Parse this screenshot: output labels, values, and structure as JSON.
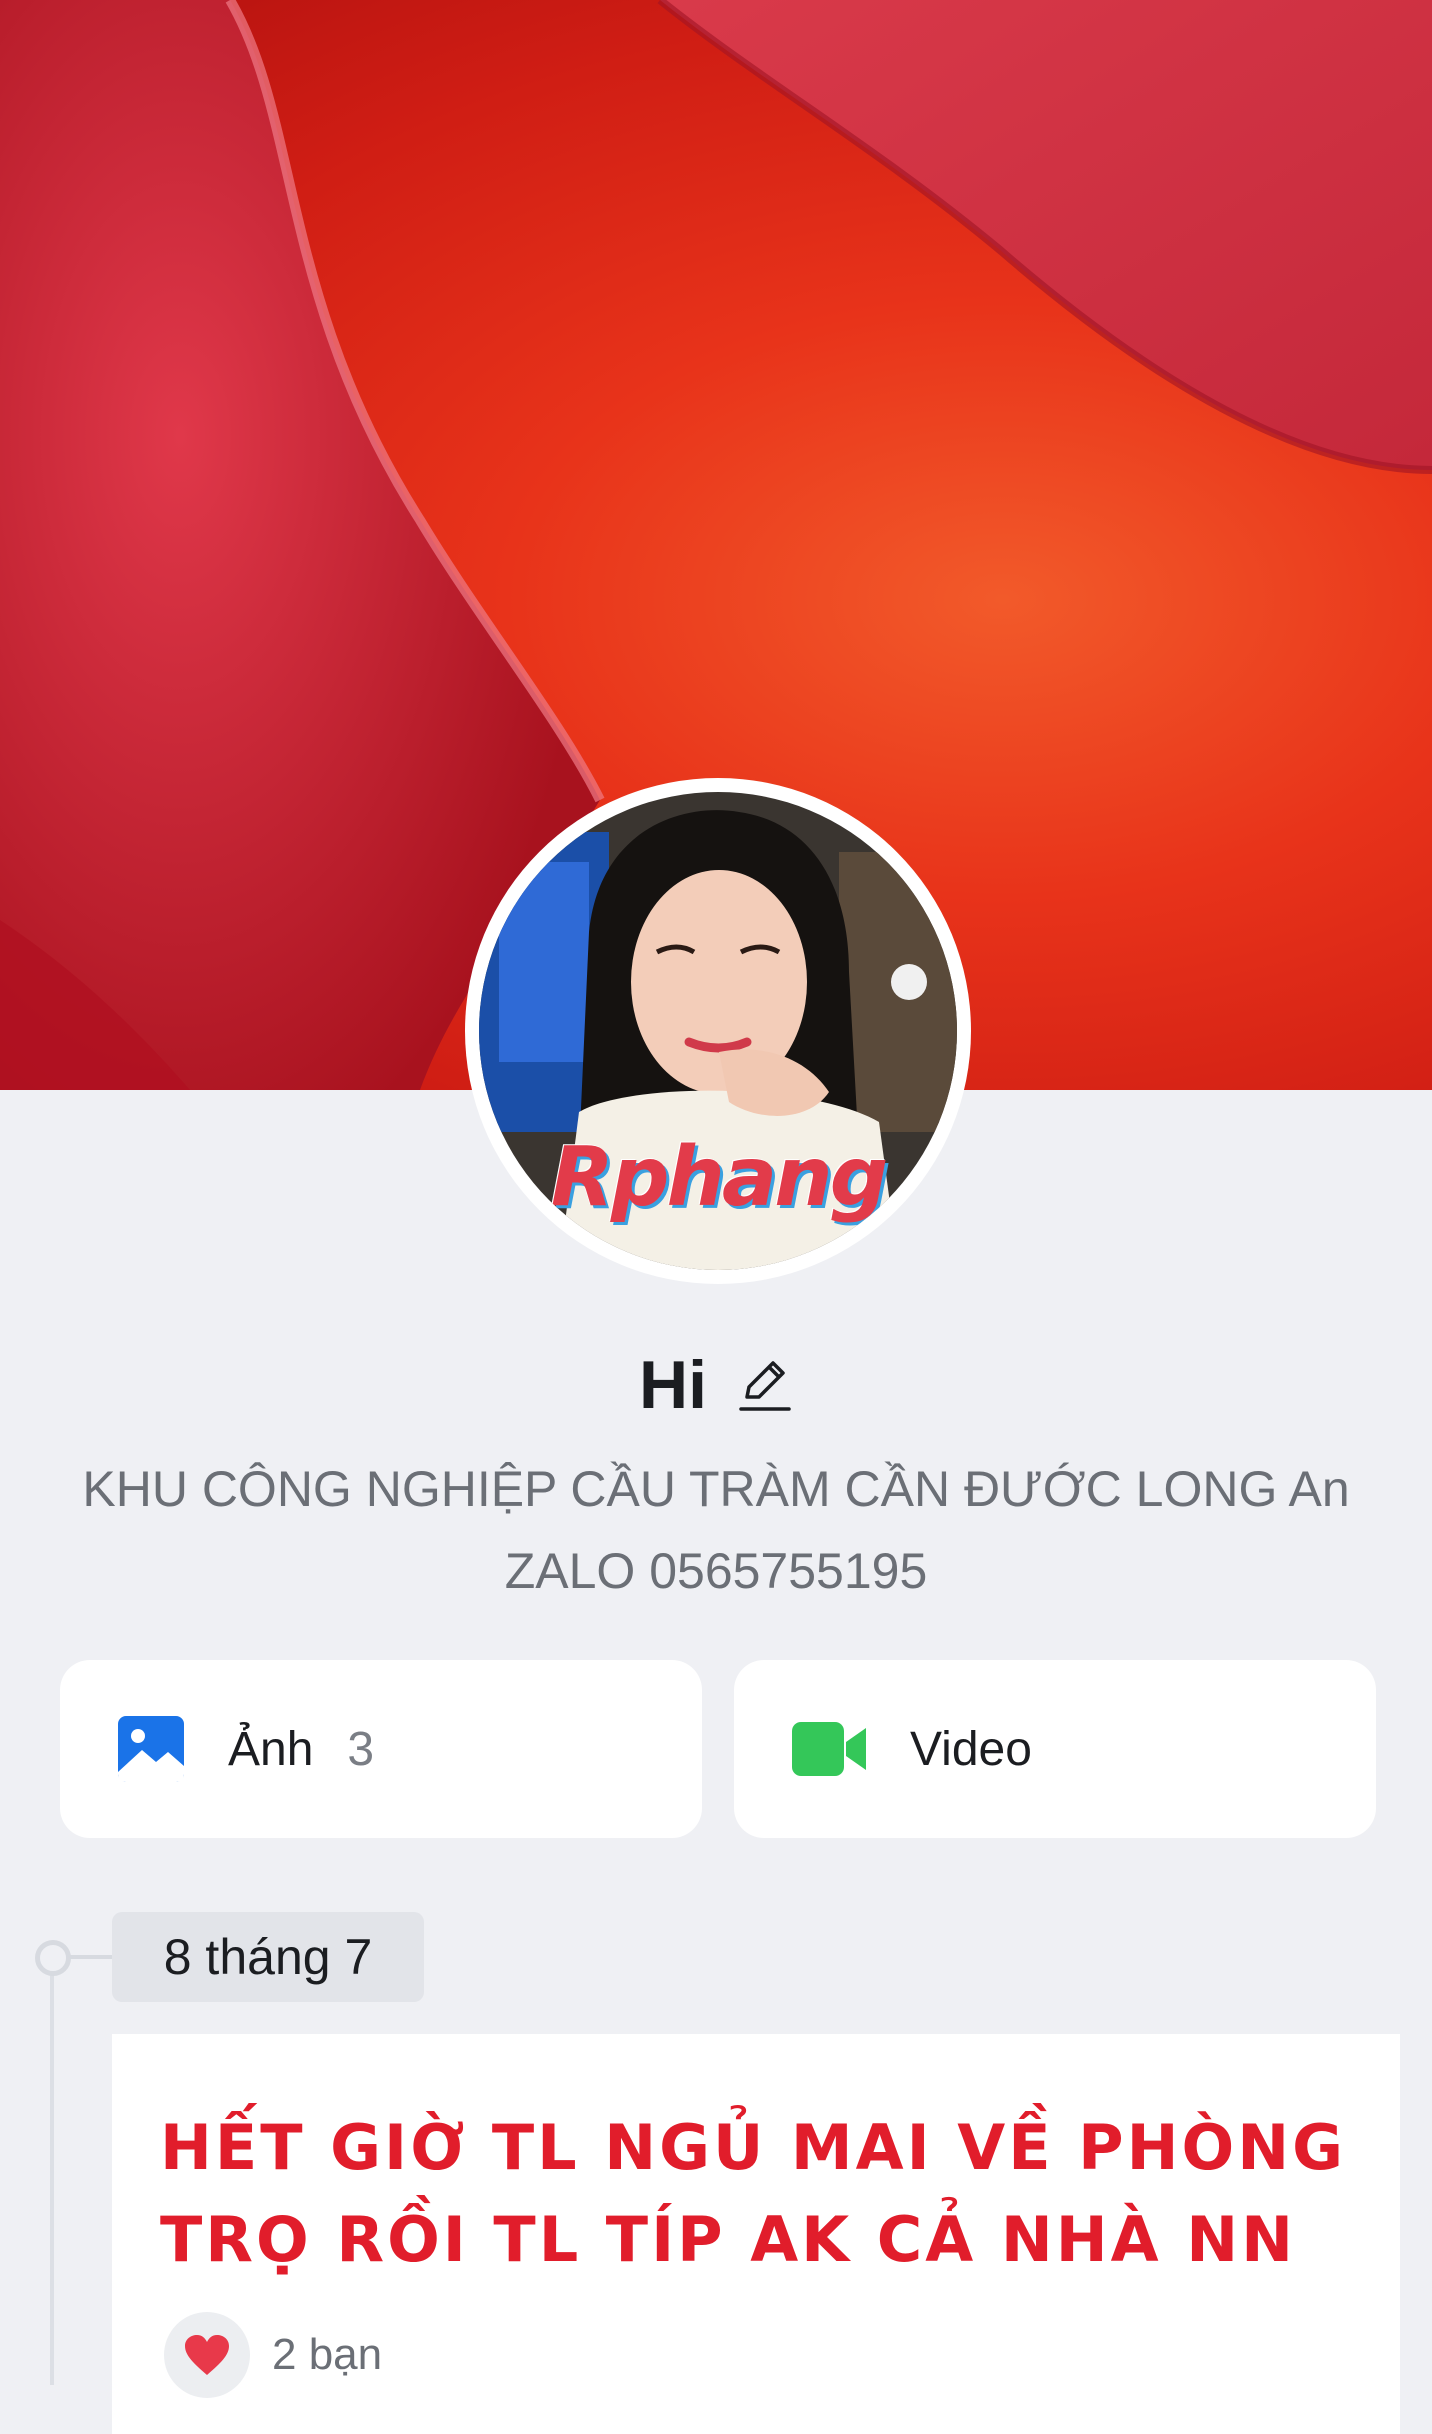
{
  "profile": {
    "name": "Hi",
    "bio_line1": "KHU CÔNG NGHIỆP CẦU TRÀM CẦN ĐƯỚC LONG An",
    "bio_line2": "ZALO 0565755195",
    "avatar_watermark": "Rphang"
  },
  "media": {
    "photos_label": "Ảnh",
    "photos_count": "3",
    "video_label": "Video"
  },
  "timeline": {
    "date": "8 tháng 7",
    "post_text": "HẾT GIỜ TL NGỦ MAI VỀ PHÒNG TRỌ RỒI TL TÍP AK CẢ NHÀ NN",
    "reaction_count": "2 bạn"
  },
  "icons": {
    "edit": "pencil-icon",
    "photos": "image-icon",
    "video": "video-camera-icon",
    "reaction": "heart-icon"
  },
  "colors": {
    "page_bg": "#eff0f4",
    "photos_icon": "#1a73e8",
    "video_icon": "#34c759",
    "post_text": "#e11d2b"
  }
}
